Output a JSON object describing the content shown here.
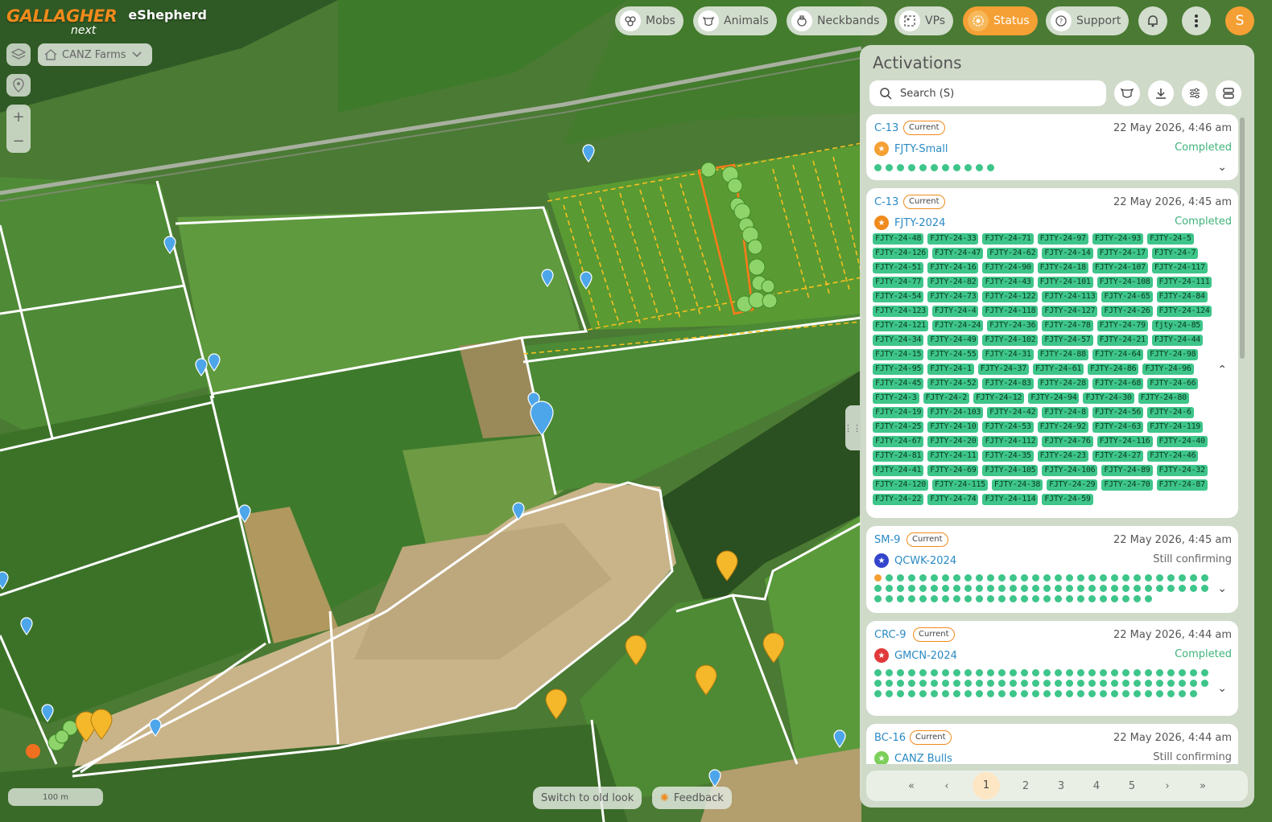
{
  "brand": {
    "name": "GALLAGHER",
    "sub": "next",
    "app": "eShepherd"
  },
  "farm_selector": {
    "label": "CANZ Farms"
  },
  "nav": [
    {
      "id": "mobs",
      "label": "Mobs",
      "icon": "mob-icon"
    },
    {
      "id": "animals",
      "label": "Animals",
      "icon": "cow-icon"
    },
    {
      "id": "neckbands",
      "label": "Neckbands",
      "icon": "neckband-icon"
    },
    {
      "id": "vps",
      "label": "VPs",
      "icon": "virtual-paddock-icon"
    },
    {
      "id": "status",
      "label": "Status",
      "icon": "status-icon",
      "active": true
    },
    {
      "id": "support",
      "label": "Support",
      "icon": "support-icon"
    }
  ],
  "user": {
    "initial": "S"
  },
  "map": {
    "scale_label": "100 m"
  },
  "buttons": {
    "old_look": "Switch to old look",
    "feedback": "Feedback"
  },
  "panel": {
    "title": "Activations",
    "search_placeholder": "Search (S)",
    "tools": [
      "cow-filter-icon",
      "download-icon",
      "sliders-icon",
      "layout-icon"
    ]
  },
  "activations": [
    {
      "code": "C-13",
      "badge": "Current",
      "time": "22 May 2026, 4:46 am",
      "mob": "FJTY-Small",
      "mob_color": "#f5a034",
      "status": "Completed",
      "status_color": "#3fb37a",
      "dot_count": 11,
      "orange_dots": 0,
      "expanded": false
    },
    {
      "code": "C-13",
      "badge": "Current",
      "time": "22 May 2026, 4:45 am",
      "mob": "FJTY-2024",
      "mob_color": "#f08a1c",
      "status": "Completed",
      "status_color": "#3fb37a",
      "expanded": true,
      "tags": [
        "FJTY-24-48",
        "FJTY-24-33",
        "FJTY-24-71",
        "FJTY-24-97",
        "FJTY-24-93",
        "FJTY-24-5",
        "FJTY-24-126",
        "FJTY-24-47",
        "FJTY-24-62",
        "FJTY-24-14",
        "FJTY-24-17",
        "FJTY-24-7",
        "FJTY-24-51",
        "FJTY-24-16",
        "FJTY-24-90",
        "FJTY-24-18",
        "FJTY-24-107",
        "FJTY-24-117",
        "FJTY-24-77",
        "FJTY-24-82",
        "FJTY-24-43",
        "FJTY-24-101",
        "FJTY-24-108",
        "FJTY-24-111",
        "FJTY-24-54",
        "FJTY-24-73",
        "FJTY-24-122",
        "FJTY-24-113",
        "FJTY-24-65",
        "FJTY-24-84",
        "FJTY-24-123",
        "FJTY-24-4",
        "FJTY-24-118",
        "FJTY-24-127",
        "FJTY-24-26",
        "FJTY-24-124",
        "FJTY-24-121",
        "FJTY-24-24",
        "FJTY-24-36",
        "FJTY-24-78",
        "FJTY-24-79",
        "fjty-24-85",
        "FJTY-24-34",
        "FJTY-24-49",
        "FJTY-24-102",
        "FJTY-24-57",
        "FJTY-24-21",
        "FJTY-24-44",
        "FJTY-24-15",
        "FJTY-24-55",
        "FJTY-24-31",
        "FJTY-24-88",
        "FJTY-24-64",
        "FJTY-24-98",
        "FJTY-24-95",
        "FJTY-24-1",
        "FJTY-24-37",
        "FJTY-24-61",
        "FJTY-24-86",
        "FJTY-24-96",
        "FJTY-24-45",
        "FJTY-24-52",
        "FJTY-24-83",
        "FJTY-24-28",
        "FJTY-24-68",
        "FJTY-24-66",
        "FJTY-24-3",
        "FJTY-24-2",
        "FJTY-24-12",
        "FJTY-24-94",
        "FJTY-24-30",
        "FJTY-24-80",
        "FJTY-24-19",
        "FJTY-24-103",
        "FJTY-24-42",
        "FJTY-24-8",
        "FJTY-24-56",
        "FJTY-24-6",
        "FJTY-24-25",
        "FJTY-24-10",
        "FJTY-24-53",
        "FJTY-24-92",
        "FJTY-24-63",
        "FJTY-24-119",
        "FJTY-24-67",
        "FJTY-24-20",
        "FJTY-24-112",
        "FJTY-24-76",
        "FJTY-24-116",
        "FJTY-24-40",
        "FJTY-24-81",
        "FJTY-24-11",
        "FJTY-24-35",
        "FJTY-24-23",
        "FJTY-24-27",
        "FJTY-24-46",
        "FJTY-24-41",
        "FJTY-24-69",
        "FJTY-24-105",
        "FJTY-24-106",
        "FJTY-24-89",
        "FJTY-24-32",
        "FJTY-24-120",
        "FJTY-24-115",
        "FJTY-24-38",
        "FJTY-24-29",
        "FJTY-24-70",
        "FJTY-24-87",
        "FJTY-24-22",
        "FJTY-24-74",
        "FJTY-24-114",
        "FJTY-24-59"
      ]
    },
    {
      "code": "SM-9",
      "badge": "Current",
      "time": "22 May 2026, 4:45 am",
      "mob": "QCWK-2024",
      "mob_color": "#3344cc",
      "status": "Still confirming",
      "status_color": "#666666",
      "dot_count": 85,
      "orange_dots": 1,
      "expanded": false
    },
    {
      "code": "CRC-9",
      "badge": "Current",
      "time": "22 May 2026, 4:44 am",
      "mob": "GMCN-2024",
      "mob_color": "#e03a3a",
      "status": "Completed",
      "status_color": "#3fb37a",
      "dot_count": 89,
      "orange_dots": 0,
      "expanded": false
    },
    {
      "code": "BC-16",
      "badge": "Current",
      "time": "22 May 2026, 4:44 am",
      "mob": "CANZ Bulls",
      "mob_color": "#7ccf5a",
      "status": "Still confirming",
      "status_color": "#666666",
      "dot_count": 0,
      "orange_dots": 0,
      "expanded": false
    }
  ],
  "pagination": {
    "first": "«",
    "prev": "‹",
    "pages": [
      "1",
      "2",
      "3",
      "4",
      "5"
    ],
    "current": "1",
    "next": "›",
    "last": "»"
  },
  "colors": {
    "accent": "#f5a034",
    "link": "#2a8ac4",
    "tag": "#3ec58a",
    "panel": "#dae2d6"
  }
}
